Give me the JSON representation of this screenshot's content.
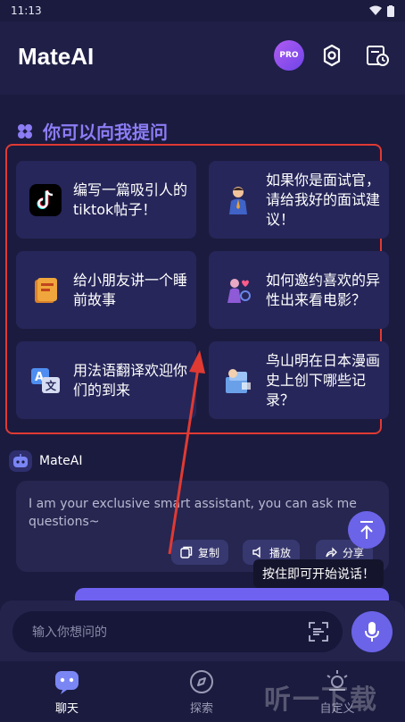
{
  "status": {
    "time": "11:13"
  },
  "header": {
    "title": "MateAI",
    "pro_label": "PRO"
  },
  "section": {
    "title": "你可以向我提问"
  },
  "cards": [
    {
      "text": "编写一篇吸引人的tiktok帖子！",
      "icon": "tiktok-icon"
    },
    {
      "text": "如果你是面试官，请给我好的面试建议！",
      "icon": "interviewer-icon"
    },
    {
      "text": "给小朋友讲一个睡前故事",
      "icon": "book-icon"
    },
    {
      "text": "如何邀约喜欢的异性出来看电影？",
      "icon": "date-icon"
    },
    {
      "text": "用法语翻译欢迎你们的到来",
      "icon": "translate-icon"
    },
    {
      "text": "鸟山明在日本漫画史上创下哪些记录？",
      "icon": "manga-icon"
    }
  ],
  "bot": {
    "name": "MateAI"
  },
  "message": {
    "text": "I am your exclusive smart assistant, you can ask me questions~",
    "copy_label": "复制",
    "play_label": "播放",
    "share_label": "分享"
  },
  "tooltip": {
    "text": "按住即可开始说话！"
  },
  "input": {
    "placeholder": "输入你想问的"
  },
  "tabs": [
    {
      "label": "聊天",
      "icon": "chat-icon",
      "active": true
    },
    {
      "label": "探索",
      "icon": "compass-icon",
      "active": false
    },
    {
      "label": "自定义",
      "icon": "custom-icon",
      "active": false
    }
  ],
  "watermark": {
    "text": "听一下载"
  },
  "colors": {
    "accent": "#6b63e8",
    "background": "#1b1b3f",
    "card": "#26265a",
    "annotation": "#e03a33"
  }
}
